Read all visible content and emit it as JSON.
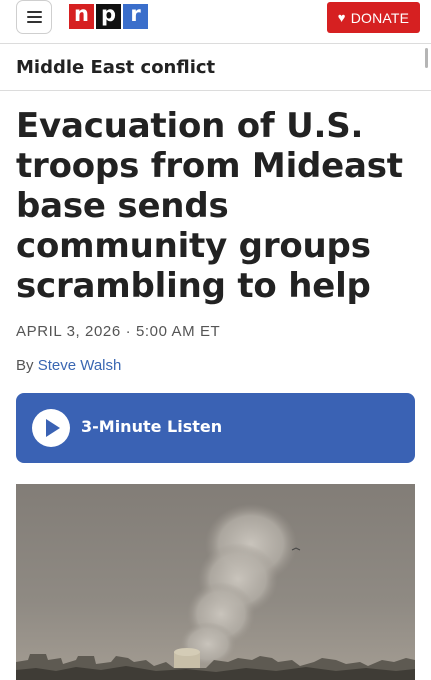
{
  "header": {
    "menu_icon": "hamburger-menu-icon",
    "logo": {
      "letters": [
        "n",
        "p",
        "r"
      ],
      "colors": [
        "#d62021",
        "#111111",
        "#3a6ecb"
      ]
    },
    "donate": {
      "icon": "heart-icon",
      "label": "DONATE",
      "color": "#d62021"
    }
  },
  "section": {
    "label": "Middle East conflict"
  },
  "article": {
    "headline": "Evacuation of U.S. troops from Mideast base sends community groups scrambling to help",
    "date": "APRIL 3, 2026 · 5:00 AM ET",
    "byline_prefix": "By",
    "author": "Steve Walsh"
  },
  "audio": {
    "icon": "play-icon",
    "label": "3-Minute Listen",
    "color": "#3a62b4"
  }
}
